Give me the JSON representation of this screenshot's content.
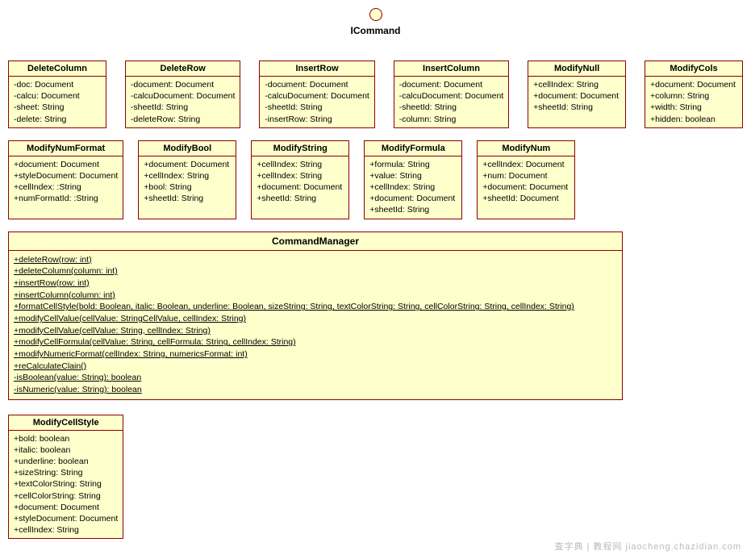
{
  "interface": {
    "name": "ICommand"
  },
  "row1": [
    {
      "title": "DeleteColumn",
      "members": [
        "-doc: Document",
        "-calcu: Document",
        "-sheet: String",
        "-delete: String"
      ]
    },
    {
      "title": "DeleteRow",
      "members": [
        "-document: Document",
        "-calcuDocument: Document",
        "-sheetId: String",
        "-deleteRow: String"
      ]
    },
    {
      "title": "InsertRow",
      "members": [
        "-document: Document",
        "-calcuDocument: Document",
        "-sheetId: String",
        "-insertRow: String"
      ]
    },
    {
      "title": "InsertColumn",
      "members": [
        "-document: Document",
        "-calcuDocument: Document",
        "-sheetId: String",
        "-column: String"
      ]
    },
    {
      "title": "ModifyNull",
      "members": [
        "+cellIndex: String",
        "+document: Document",
        "+sheetId: String"
      ]
    },
    {
      "title": "ModifyCols",
      "members": [
        "+document: Document",
        "+column: String",
        "+width: String",
        "+hidden: boolean"
      ]
    }
  ],
  "row2": [
    {
      "title": "ModifyNumFormat",
      "members": [
        "+document: Document",
        "+styleDocument: Document",
        "+cellIndex: :String",
        "+numFormatId: :String"
      ]
    },
    {
      "title": "ModifyBool",
      "members": [
        "+document: Document",
        "+cellIndex: String",
        "+bool: String",
        "+sheetId: String"
      ]
    },
    {
      "title": "ModifyString",
      "members": [
        "+cellIndex: String",
        "+cellIndex: String",
        "+document: Document",
        "+sheetId: String"
      ]
    },
    {
      "title": "ModifyFormula",
      "members": [
        "+formula: String",
        "+value: String",
        "+cellIndex: String",
        "+document: Document",
        "+sheetId: String"
      ]
    },
    {
      "title": "ModifyNum",
      "members": [
        "+cellIndex: Document",
        "+num: Document",
        "+document: Document",
        "+sheetId: Document"
      ]
    },
    {
      "title": "ModifyCellStyle",
      "members": [
        "+bold: boolean",
        "+italic: boolean",
        "+underline: boolean",
        "+sizeString: String",
        "+textColorString: String",
        "+cellColorString: String",
        "+document: Document",
        "+styleDocument: Document",
        "+cellIndex: String"
      ]
    }
  ],
  "manager": {
    "title": "CommandManager",
    "methods": [
      "+deleteRow(row: int)",
      "+deleteColumn(column: int)",
      "+insertRow(row: int)",
      "+insertColumn(column: int)",
      "+formatCellStyle(bold: Boolean, italic: Boolean, underline: Boolean, sizeString: String, textColorString: String, cellColorString: String, cellIndex: String)",
      "+modifyCellValue(cellValue: StringCellValue, cellIndex: String)",
      "+modifyCellValue(cellValue: String, cellIndex: String)",
      "+modifyCellFormula(cellValue: String, cellFormula: String, cellIndex: String)",
      "+modifyNumericFormat(cellIndex: String, numericsFormat: int)",
      "+reCalculateClain()",
      "-isBoolean(value: String): boolean",
      "-isNumeric(value: String): boolean"
    ]
  },
  "watermark": "查字典 | 教程网  jiaocheng.chazidian.com",
  "chart_data": {
    "type": "table",
    "description": "UML class diagram showing ICommand interface with implementing command classes and a CommandManager facade.",
    "interface": "ICommand",
    "classes": [
      {
        "name": "DeleteColumn",
        "attributes": [
          "-doc: Document",
          "-calcu: Document",
          "-sheet: String",
          "-delete: String"
        ]
      },
      {
        "name": "DeleteRow",
        "attributes": [
          "-document: Document",
          "-calcuDocument: Document",
          "-sheetId: String",
          "-deleteRow: String"
        ]
      },
      {
        "name": "InsertRow",
        "attributes": [
          "-document: Document",
          "-calcuDocument: Document",
          "-sheetId: String",
          "-insertRow: String"
        ]
      },
      {
        "name": "InsertColumn",
        "attributes": [
          "-document: Document",
          "-calcuDocument: Document",
          "-sheetId: String",
          "-column: String"
        ]
      },
      {
        "name": "ModifyNull",
        "attributes": [
          "+cellIndex: String",
          "+document: Document",
          "+sheetId: String"
        ]
      },
      {
        "name": "ModifyCols",
        "attributes": [
          "+document: Document",
          "+column: String",
          "+width: String",
          "+hidden: boolean"
        ]
      },
      {
        "name": "ModifyNumFormat",
        "attributes": [
          "+document: Document",
          "+styleDocument: Document",
          "+cellIndex: :String",
          "+numFormatId: :String"
        ]
      },
      {
        "name": "ModifyBool",
        "attributes": [
          "+document: Document",
          "+cellIndex: String",
          "+bool: String",
          "+sheetId: String"
        ]
      },
      {
        "name": "ModifyString",
        "attributes": [
          "+cellIndex: String",
          "+cellIndex: String",
          "+document: Document",
          "+sheetId: String"
        ]
      },
      {
        "name": "ModifyFormula",
        "attributes": [
          "+formula: String",
          "+value: String",
          "+cellIndex: String",
          "+document: Document",
          "+sheetId: String"
        ]
      },
      {
        "name": "ModifyNum",
        "attributes": [
          "+cellIndex: Document",
          "+num: Document",
          "+document: Document",
          "+sheetId: Document"
        ]
      },
      {
        "name": "ModifyCellStyle",
        "attributes": [
          "+bold: boolean",
          "+italic: boolean",
          "+underline: boolean",
          "+sizeString: String",
          "+textColorString: String",
          "+cellColorString: String",
          "+document: Document",
          "+styleDocument: Document",
          "+cellIndex: String"
        ]
      },
      {
        "name": "CommandManager",
        "operations": [
          "+deleteRow(row: int)",
          "+deleteColumn(column: int)",
          "+insertRow(row: int)",
          "+insertColumn(column: int)",
          "+formatCellStyle(bold: Boolean, italic: Boolean, underline: Boolean, sizeString: String, textColorString: String, cellColorString: String, cellIndex: String)",
          "+modifyCellValue(cellValue: StringCellValue, cellIndex: String)",
          "+modifyCellValue(cellValue: String, cellIndex: String)",
          "+modifyCellFormula(cellValue: String, cellFormula: String, cellIndex: String)",
          "+modifyNumericFormat(cellIndex: String, numericsFormat: int)",
          "+reCalculateClain()",
          "-isBoolean(value: String): boolean",
          "-isNumeric(value: String): boolean"
        ]
      }
    ]
  }
}
